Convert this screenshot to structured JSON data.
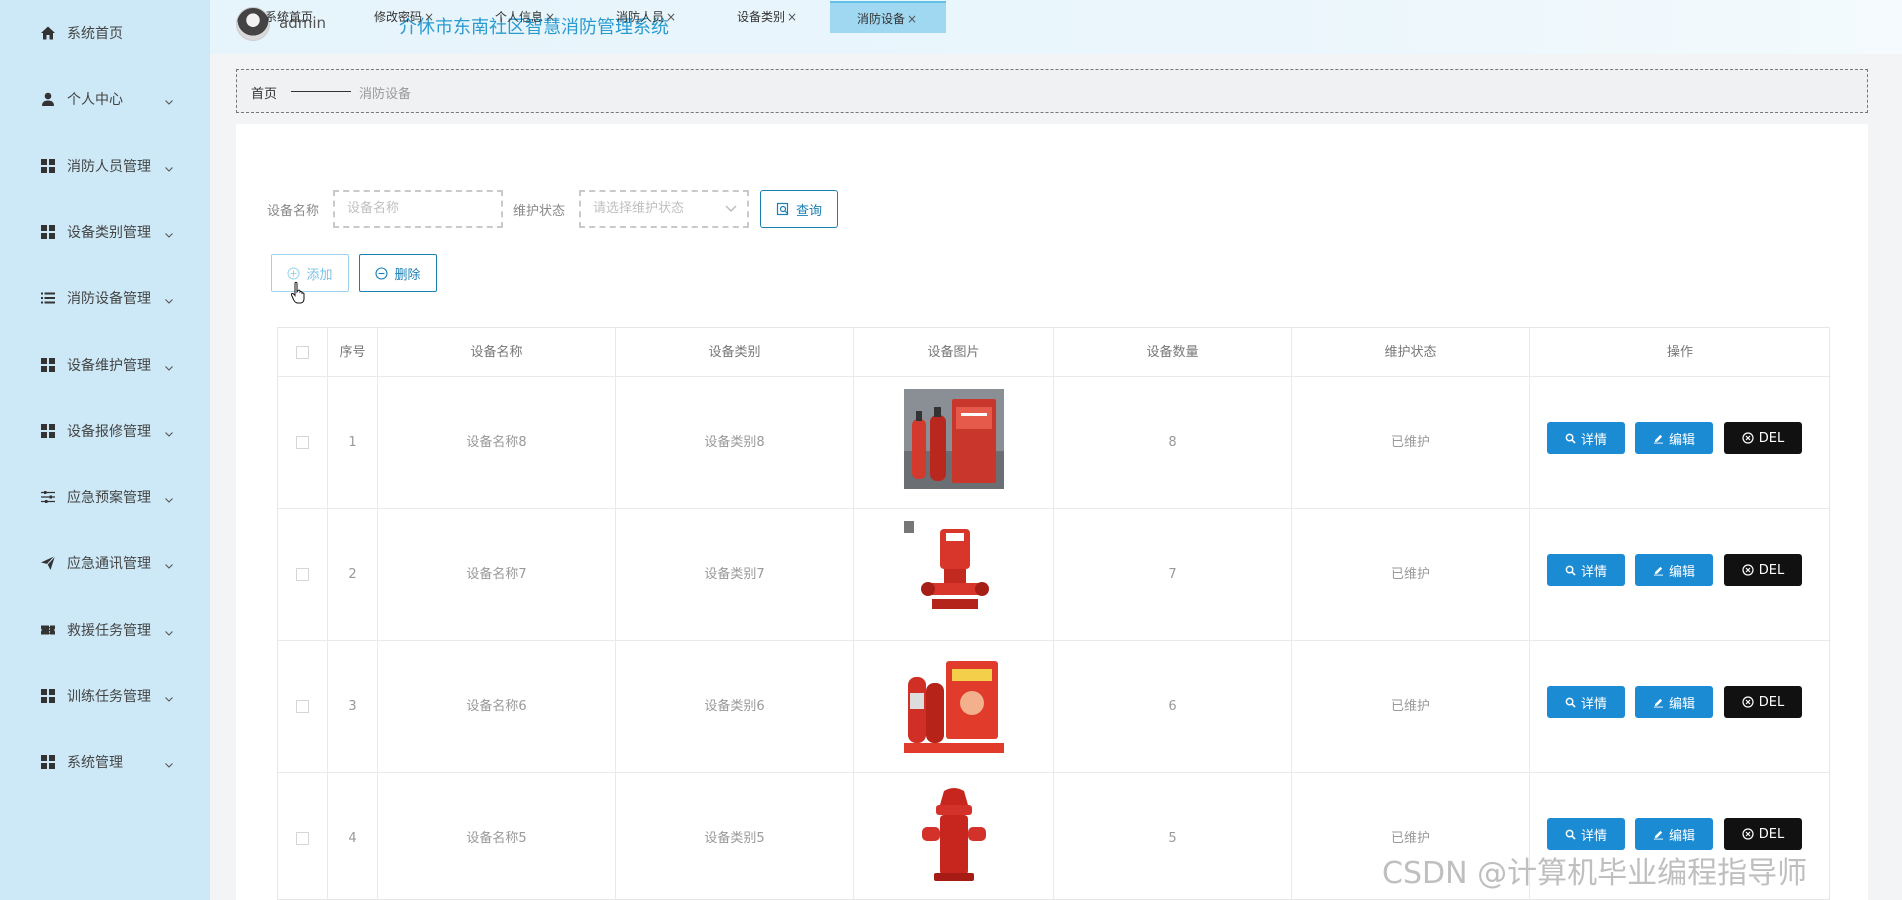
{
  "header": {
    "username": "admin",
    "system_title": "介休市东南社区智慧消防管理系统"
  },
  "sidebar": {
    "items": [
      {
        "label": "系统首页",
        "icon": "home-icon",
        "has_chevron": false
      },
      {
        "label": "个人中心",
        "icon": "user-icon",
        "has_chevron": true
      },
      {
        "label": "消防人员管理",
        "icon": "grid-icon",
        "has_chevron": true
      },
      {
        "label": "设备类别管理",
        "icon": "grid-icon",
        "has_chevron": true
      },
      {
        "label": "消防设备管理",
        "icon": "list-icon",
        "has_chevron": true
      },
      {
        "label": "设备维护管理",
        "icon": "grid-icon",
        "has_chevron": true
      },
      {
        "label": "设备报修管理",
        "icon": "grid-icon",
        "has_chevron": true
      },
      {
        "label": "应急预案管理",
        "icon": "sliders-icon",
        "has_chevron": true
      },
      {
        "label": "应急通讯管理",
        "icon": "send-icon",
        "has_chevron": true
      },
      {
        "label": "救援任务管理",
        "icon": "ticket-icon",
        "has_chevron": true
      },
      {
        "label": "训练任务管理",
        "icon": "grid-icon",
        "has_chevron": true
      },
      {
        "label": "系统管理",
        "icon": "grid-icon",
        "has_chevron": true
      }
    ]
  },
  "breadcrumb": {
    "home": "首页",
    "current": "消防设备"
  },
  "tabs": [
    {
      "label": "系统首页",
      "closable": false,
      "active": false
    },
    {
      "label": "修改密码",
      "closable": true,
      "active": false
    },
    {
      "label": "个人信息",
      "closable": true,
      "active": false
    },
    {
      "label": "消防人员",
      "closable": true,
      "active": false
    },
    {
      "label": "设备类别",
      "closable": true,
      "active": false
    },
    {
      "label": "消防设备",
      "closable": true,
      "active": true
    }
  ],
  "tab_close_glyph": "×",
  "search": {
    "name_label": "设备名称",
    "name_placeholder": "设备名称",
    "status_label": "维护状态",
    "status_placeholder": "请选择维护状态",
    "query_button": "查询"
  },
  "actions": {
    "add": "添加",
    "delete": "删除"
  },
  "table": {
    "headers": [
      "序号",
      "设备名称",
      "设备类别",
      "设备图片",
      "设备数量",
      "维护状态",
      "操作"
    ],
    "rows": [
      {
        "index": "1",
        "name": "设备名称8",
        "category": "设备类别8",
        "image": "extinguisher-cabinet",
        "quantity": "8",
        "status": "已维护"
      },
      {
        "index": "2",
        "name": "设备名称7",
        "category": "设备类别7",
        "image": "fire-pump",
        "quantity": "7",
        "status": "已维护"
      },
      {
        "index": "3",
        "name": "设备名称6",
        "category": "设备类别6",
        "image": "extinguisher-box",
        "quantity": "6",
        "status": "已维护"
      },
      {
        "index": "4",
        "name": "设备名称5",
        "category": "设备类别5",
        "image": "fire-hydrant",
        "quantity": "5",
        "status": "已维护"
      }
    ],
    "op_buttons": {
      "detail": "详情",
      "edit": "编辑",
      "del": "DEL"
    }
  },
  "watermark": "CSDN @计算机毕业编程指导师",
  "colors": {
    "sidebar_bg": "#cde9f7",
    "accent": "#1b8bd4",
    "title": "#2a9bd0",
    "active_tab": "#9fd8f0",
    "del_button": "#111111"
  }
}
